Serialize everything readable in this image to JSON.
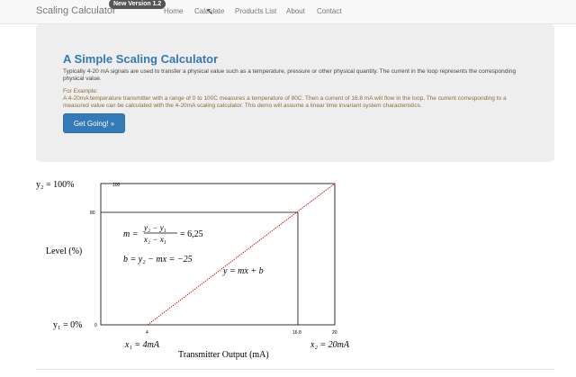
{
  "navbar": {
    "brand": "Scaling Calculator",
    "version_badge": "New Version 1.2",
    "links": [
      "Home",
      "Calculate",
      "Products List",
      "About",
      "Contact"
    ]
  },
  "hero": {
    "title": "A Simple Scaling Calculator",
    "lead": "Typically 4-20 mA signals are used to transfer a physical value such as a temperature, pressure or other physical quantity. The current in the loop represents the corresponding physical value.",
    "example_title": "For Example:",
    "example_text": "A 4-20mA temperature transmitter with a range of 0 to 100C measures a temperature of 80C. Then a current of 16.8 mA will flow in the loop. The current corresponding to a measured value can be calculated with the 4-20mA scaling calculator. This demo will assume a linear time invariant system characteristics.",
    "button_label": "Get Going! »"
  },
  "graph": {
    "y2_label": "y₂ = 100%",
    "y1_label": "y₁ = 0%",
    "y_axis_label": "Level (%)",
    "x_axis_label": "Transmitter Output (mA)",
    "x1_label": "x₁ = 4mA",
    "x2_label": "x₂ = 20mA",
    "tick_100": "100",
    "tick_80": "80",
    "tick_0": "0",
    "tick_4": "4",
    "tick_16_8": "16.8",
    "tick_20": "20",
    "eq_m_lhs": "m =",
    "eq_m_num": "y₂ − y₁",
    "eq_m_den": "x₂ − x₁",
    "eq_m_result": "= 6,25",
    "eq_b": "b = y₂ − mx = −25",
    "eq_line": "y = mx + b",
    "line_color": "#cc0000"
  }
}
